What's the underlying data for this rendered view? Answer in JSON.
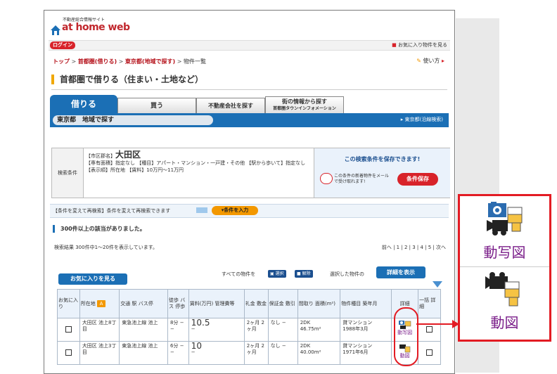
{
  "header": {
    "site_sub": "不動産総合情報サイト",
    "logo": "at home web",
    "login": "ログイン",
    "favorites_link": "お気に入り物件を見る"
  },
  "breadcrumb": {
    "top": "トップ",
    "rent_metro": "首都圏(借りる)",
    "tokyo_area": "東京都(地域で探す)",
    "current": "物件一覧",
    "sep": ">"
  },
  "howto": "使い方",
  "page_title": "首都圏で借りる（住まい・土地など）",
  "tabs": {
    "rent": "借りる",
    "buy": "買う",
    "company": "不動産会社を探す",
    "town_line1": "街の情報から探す",
    "town_line2": "首都圏タウンインフォメーション"
  },
  "area_bar": {
    "label": "東京都　地域で探す",
    "link": "東京都(沿線検索)"
  },
  "conditions": {
    "label": "検索条件",
    "ward_prefix": "【市区郡名】",
    "ward": "大田区",
    "details": "【専有面積】指定なし 【種目】アパート・マンション・一戸建・その他 【駅から歩いて】指定なし 【表示順】所在地 【賃料】10万円〜11万円"
  },
  "save": {
    "title": "この検索条件を保存できます!",
    "note": "この条件の新着物件をメールで受け取れます!",
    "button": "条件保存"
  },
  "research": {
    "text": "【条件を変えて再検索】条件を変えて再検索できます",
    "button": "▾条件を入力"
  },
  "results": {
    "hits": "300件以上の該当がありました。",
    "count_line": "検索結果 300件中1〜20件を表示しています。",
    "pagination": "前へ | 1 | 2 | 3 | 4 | 5 | 次へ"
  },
  "actions": {
    "favorites_button": "お気に入りを見る",
    "all_items": "すべての物件を",
    "select": "選択",
    "deselect": "解除",
    "selected_items": "選択した物件の",
    "detail_button": "詳細を表示"
  },
  "table": {
    "headers": {
      "fav": "お気に入り",
      "location": "所在地",
      "location_mark": "A",
      "transport": "交通 駅 バス停",
      "walk": "徒歩 バス 停歩",
      "rent": "賃料(万円) 管理費等",
      "key_money": "礼金 敷金",
      "deposit": "保証金 敷引",
      "layout": "間取り 面積(m²)",
      "type": "物件種目 築年月",
      "detail": "詳細",
      "bulk": "一括 詳細"
    },
    "rows": [
      {
        "location": "大田区 池上8丁目",
        "transport": "東急池上線 池上",
        "walk": "8分 − −",
        "rent": "10.5",
        "rent_sub": "−",
        "key_money": "2ヶ月 2ヶ月",
        "deposit": "なし −",
        "layout": "2DK",
        "area": "46.75m²",
        "type": "貸マンション",
        "built": "1988年3月",
        "icon_caption": "動写図"
      },
      {
        "location": "大田区 池上3丁目",
        "transport": "東急池上線 池上",
        "walk": "6分 − −",
        "rent": "10",
        "rent_sub": "−",
        "key_money": "2ヶ月 2ヶ月",
        "deposit": "なし −",
        "layout": "2DK",
        "area": "40.00m²",
        "type": "貸マンション",
        "built": "1971年6月",
        "icon_caption": "動図"
      }
    ]
  },
  "callout": {
    "top_caption": "動写図",
    "bottom_caption": "動図"
  },
  "colors": {
    "brand_red": "#d8232a",
    "brand_blue": "#1b6fb5",
    "accent_orange": "#f39800",
    "caption_purple": "#7b1f8a"
  }
}
